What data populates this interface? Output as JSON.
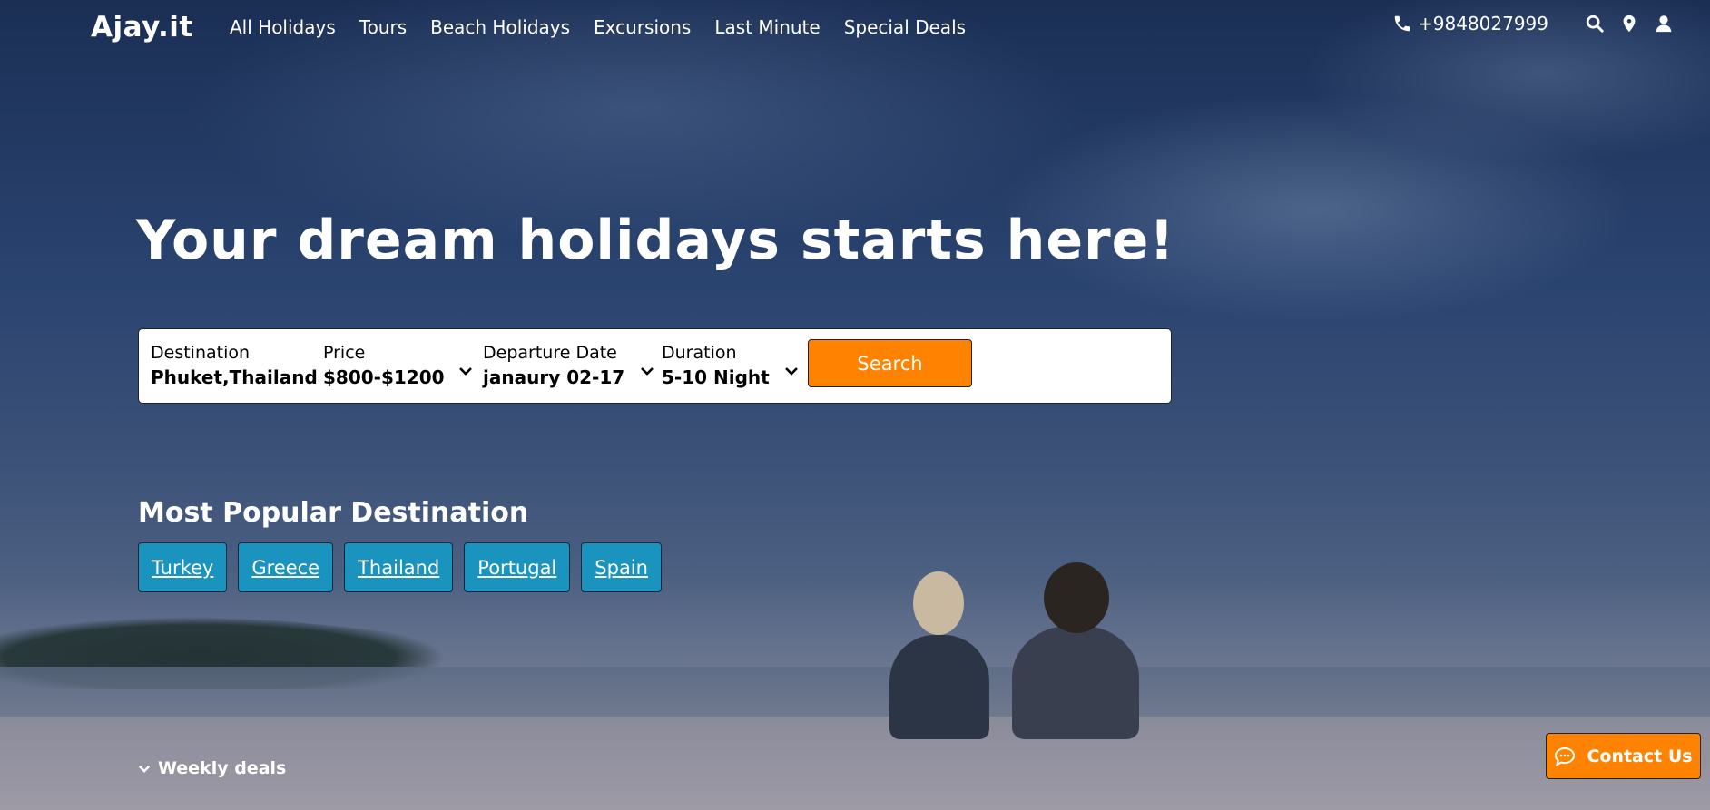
{
  "brand": {
    "logo": "Ajay.it"
  },
  "nav": {
    "items": [
      {
        "label": "All Holidays"
      },
      {
        "label": "Tours"
      },
      {
        "label": "Beach Holidays"
      },
      {
        "label": "Excursions"
      },
      {
        "label": "Last Minute"
      },
      {
        "label": "Special Deals"
      }
    ],
    "phone": "+9848027999",
    "icons": [
      "phone-icon",
      "search-icon",
      "location-pin-icon",
      "user-icon"
    ]
  },
  "hero": {
    "headline": "Your dream holidays starts here!"
  },
  "search": {
    "destination": {
      "label": "Destination",
      "value": "Phuket,Thailand"
    },
    "price": {
      "label": "Price",
      "value": "$800-$1200"
    },
    "departure": {
      "label": "Departure Date",
      "value": "janaury 02-17"
    },
    "duration": {
      "label": "Duration",
      "value": "5-10 Night"
    },
    "button_label": "Search"
  },
  "popular": {
    "title": "Most Popular Destination",
    "destinations": [
      {
        "label": "Turkey"
      },
      {
        "label": "Greece"
      },
      {
        "label": "Thailand"
      },
      {
        "label": "Portugal"
      },
      {
        "label": "Spain"
      }
    ]
  },
  "weekly_deals": {
    "label": "Weekly deals"
  },
  "contact": {
    "label": "Contact Us"
  },
  "colors": {
    "accent": "#ff8200",
    "chip": "#1a94bf",
    "text_light": "#ffffff"
  }
}
